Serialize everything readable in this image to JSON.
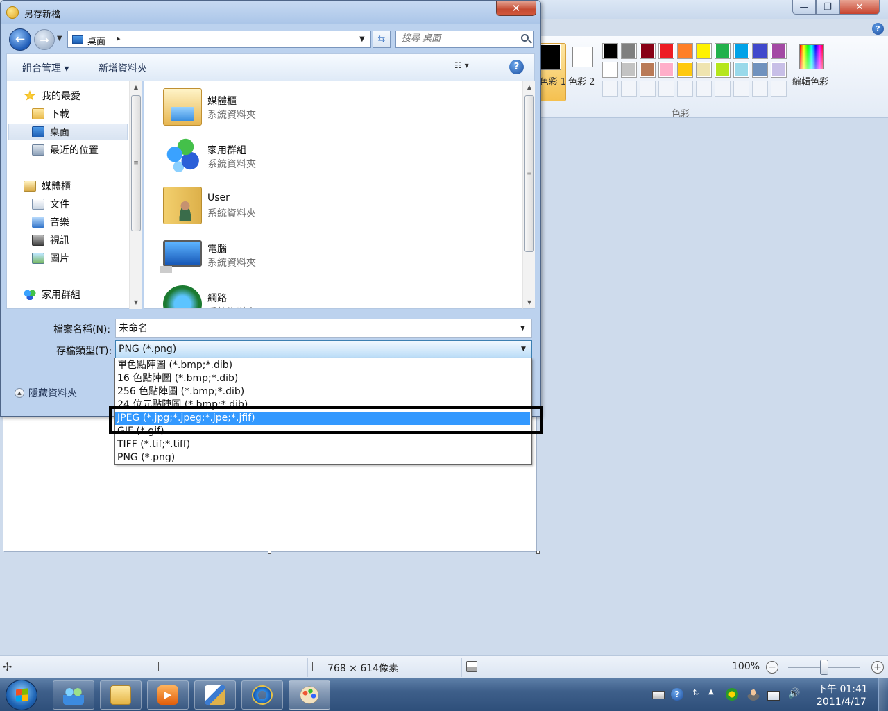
{
  "paint": {
    "window_controls": {
      "minimize": "—",
      "maximize": "❐",
      "close": "✕"
    },
    "help_glyph": "?",
    "ribbon": {
      "color1_label": "色彩 1",
      "color2_label": "色彩 2",
      "edit_colors_label": "編輯色彩",
      "colors_group_label": "色彩",
      "palette": [
        "#000000",
        "#7f7f7f",
        "#880015",
        "#ed1c24",
        "#ff7f27",
        "#fff200",
        "#22b14c",
        "#00a2e8",
        "#3f48cc",
        "#a349a4",
        "#ffffff",
        "#c3c3c3",
        "#b97a57",
        "#ffaec9",
        "#ffc90e",
        "#efe4b0",
        "#b5e61d",
        "#99d9ea",
        "#7092be",
        "#c8bfe7"
      ]
    },
    "status": {
      "canvas_size": "768 × 614像素",
      "zoom": "100%",
      "zoom_minus": "−",
      "zoom_plus": "+",
      "zoom_level": 0.5
    }
  },
  "dialog": {
    "title": "另存新檔",
    "close_glyph": "✕",
    "nav": {
      "back": "←",
      "forward": "→"
    },
    "address": {
      "location": "桌面",
      "separator": "▸"
    },
    "search": {
      "placeholder": "搜尋 桌面"
    },
    "toolbar": {
      "organize": "組合管理 ▾",
      "new_folder": "新增資料夾",
      "view": "☷ ▾",
      "help": "?"
    },
    "nav_pane": [
      {
        "label": "我的最愛",
        "icon": "star-icon"
      },
      {
        "label": "下載",
        "icon": "downloads-folder-icon"
      },
      {
        "label": "桌面",
        "icon": "desktop-icon",
        "selected": true
      },
      {
        "label": "最近的位置",
        "icon": "recent-places-icon"
      },
      {
        "label": "媒體櫃",
        "icon": "libraries-icon"
      },
      {
        "label": "文件",
        "icon": "documents-icon"
      },
      {
        "label": "音樂",
        "icon": "music-icon"
      },
      {
        "label": "視訊",
        "icon": "videos-icon"
      },
      {
        "label": "圖片",
        "icon": "pictures-icon"
      },
      {
        "label": "家用群組",
        "icon": "homegroup-icon"
      }
    ],
    "files": [
      {
        "name": "媒體櫃",
        "type": "系統資料夾",
        "icon": "libraries-folder-icon"
      },
      {
        "name": "家用群組",
        "type": "系統資料夾",
        "icon": "homegroup-icon"
      },
      {
        "name": "User",
        "type": "系統資料夾",
        "icon": "user-folder-icon"
      },
      {
        "name": "電腦",
        "type": "系統資料夾",
        "icon": "computer-icon"
      },
      {
        "name": "網路",
        "type": "系統資料夾",
        "icon": "network-icon"
      }
    ],
    "filename": {
      "label": "檔案名稱(N):",
      "value": "未命名"
    },
    "filetype": {
      "label": "存檔類型(T):",
      "selected": "PNG (*.png)",
      "options": [
        "單色點陣圖 (*.bmp;*.dib)",
        "16 色點陣圖 (*.bmp;*.dib)",
        "256 色點陣圖 (*.bmp;*.dib)",
        "24 位元點陣圖 (*.bmp;*.dib)",
        "JPEG (*.jpg;*.jpeg;*.jpe;*.jfif)",
        "GIF (*.gif)",
        "TIFF (*.tif;*.tiff)",
        "PNG (*.png)"
      ],
      "highlighted_index": 4
    },
    "hide_folders": "隱藏資料夾"
  },
  "taskbar": {
    "apps": [
      {
        "name": "windows-live-messenger",
        "icon": "users-icon"
      },
      {
        "name": "windows-explorer",
        "icon": "folder-icon"
      },
      {
        "name": "windows-media-player",
        "icon": "media-player-icon"
      },
      {
        "name": "drawing-app",
        "icon": "drawing-icon"
      },
      {
        "name": "internet-explorer",
        "icon": "ie-icon"
      },
      {
        "name": "paint",
        "icon": "paint-icon",
        "active": true
      }
    ],
    "tray": {
      "help": "?",
      "arrows": "⇅",
      "up": "▲",
      "volume": "🔊"
    },
    "clock": {
      "time": "下午 01:41",
      "date": "2011/4/17"
    }
  }
}
